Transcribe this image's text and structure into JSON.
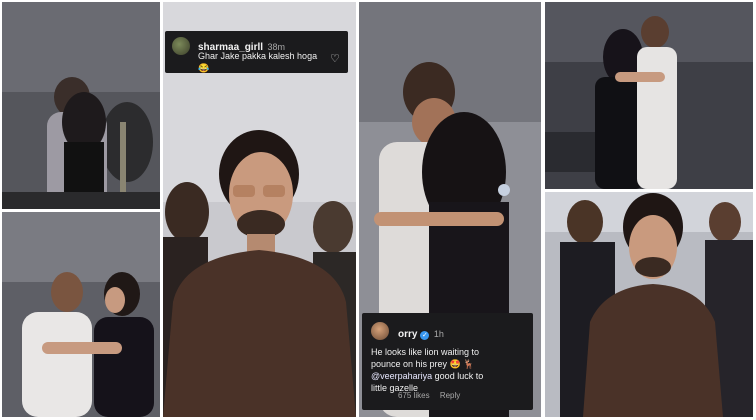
{
  "comments": {
    "top": {
      "username": "sharmaa_girll",
      "time": "38m",
      "text": "Ghar Jake pakka kalesh hoga 😂"
    },
    "bottom": {
      "username": "orry",
      "time": "1h",
      "text_line1": "He looks like lion waiting to",
      "text_line2": "pounce on his prey 🤩 🦌",
      "mention": "@veerpahariya",
      "text_line3_rest": " good luck to",
      "text_line4": "little gazelle",
      "likes": "675 likes",
      "reply": "Reply"
    }
  },
  "icons": {
    "heart": "heart-outline-icon",
    "verified": "verified-badge-icon"
  },
  "colors": {
    "background": "#ffffff",
    "comment_bg": "#1b1b1d",
    "verified": "#3897f0"
  }
}
